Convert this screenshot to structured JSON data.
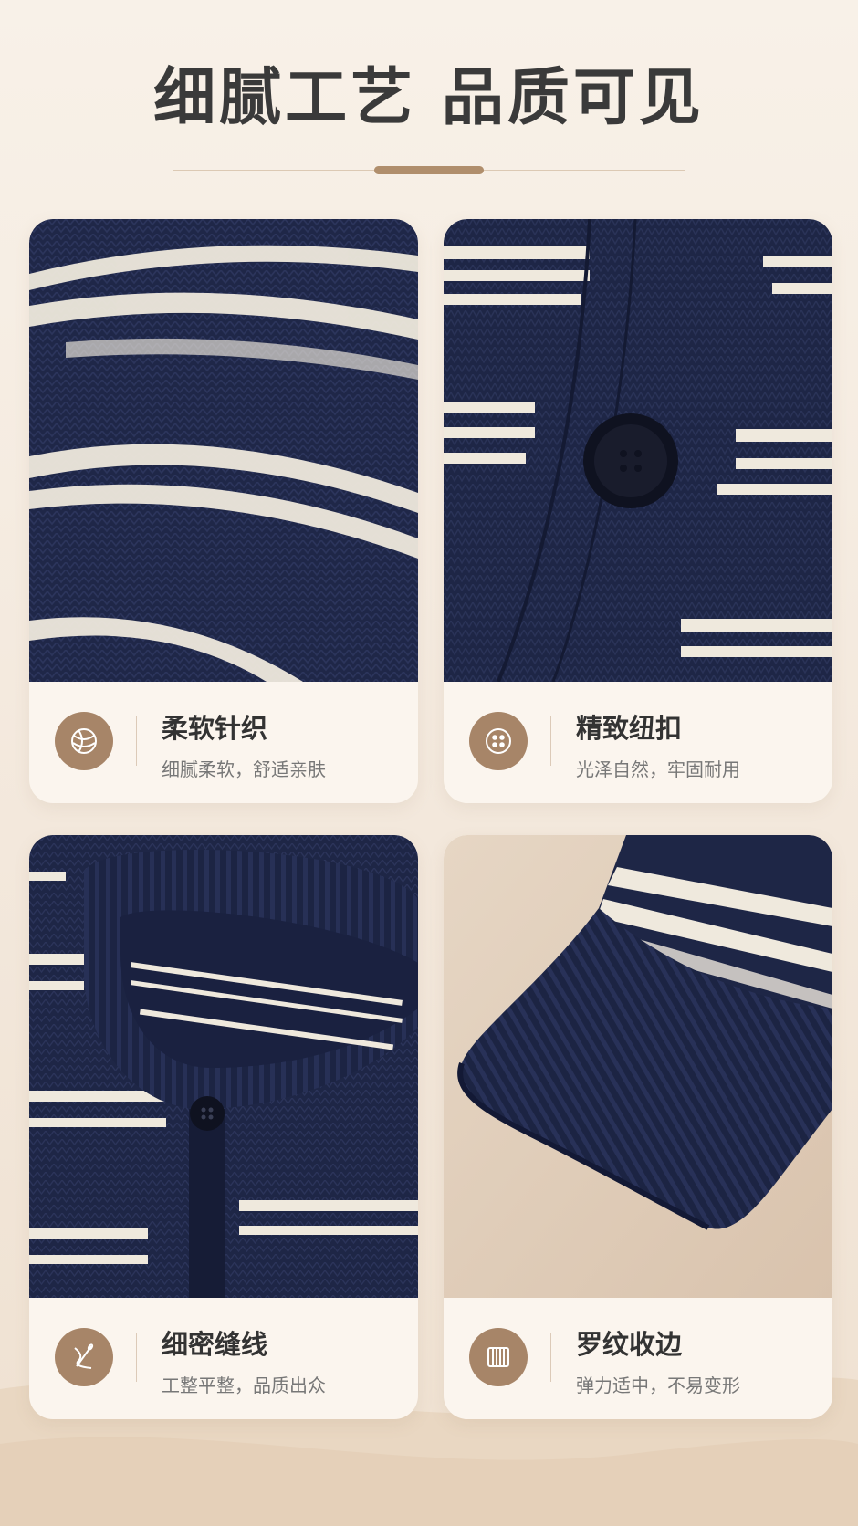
{
  "header": {
    "title": "细腻工艺 品质可见"
  },
  "features": [
    {
      "title": "柔软针织",
      "subtitle": "细腻柔软，舒适亲肤",
      "icon": "yarn-ball-icon"
    },
    {
      "title": "精致纽扣",
      "subtitle": "光泽自然，牢固耐用",
      "icon": "button-icon"
    },
    {
      "title": "细密缝线",
      "subtitle": "工整平整，品质出众",
      "icon": "needle-thread-icon"
    },
    {
      "title": "罗纹收边",
      "subtitle": "弹力适中，不易变形",
      "icon": "ribbed-cuff-icon"
    }
  ],
  "colors": {
    "navy": "#1f2748",
    "stripe": "#f3eee4",
    "accent": "#a78568",
    "background": "#f5ebe0"
  }
}
